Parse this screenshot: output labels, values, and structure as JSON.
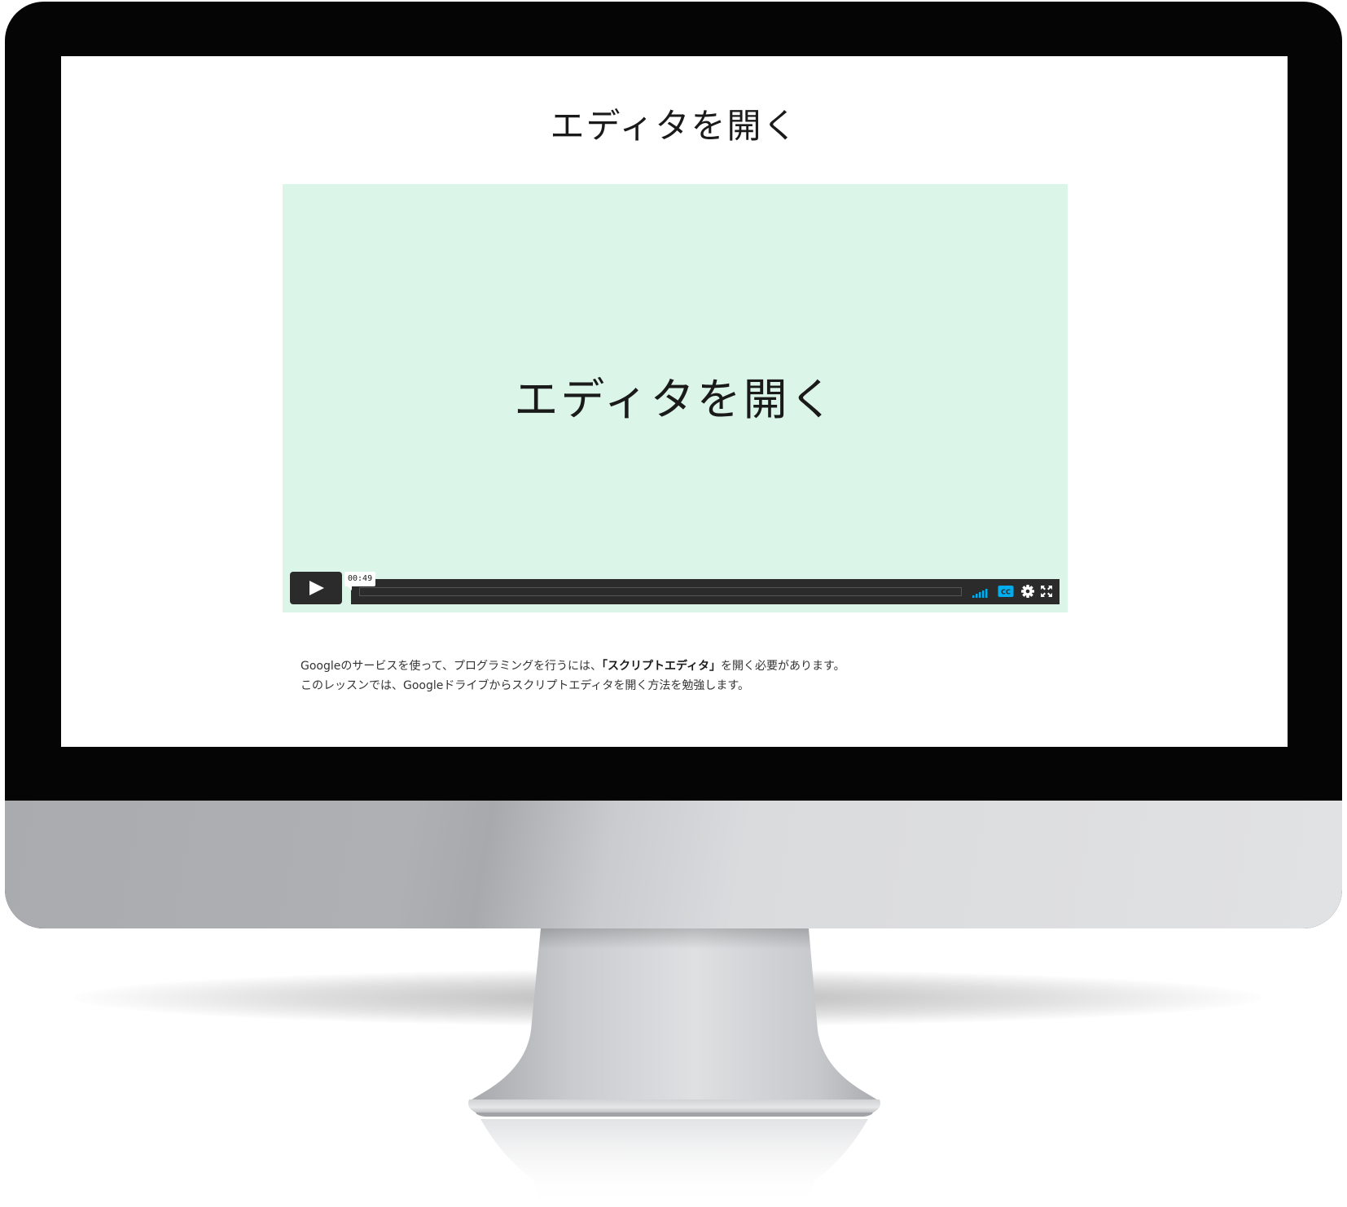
{
  "page": {
    "title": "エディタを開く"
  },
  "video": {
    "title_card": "エディタを開く",
    "time_tooltip": "00:49",
    "progress": 0,
    "colors": {
      "background": "#dbf5e8",
      "controls": "#2b2b2b",
      "accent": "#00adef"
    },
    "icons": {
      "play": "play-icon",
      "volume": "volume-icon",
      "captions": "closed-captions-icon",
      "settings": "gear-icon",
      "fullscreen": "fullscreen-icon"
    }
  },
  "description": {
    "line1_before": "Googleのサービスを使って、プログラミングを行うには、",
    "line1_bold": "「スクリプトエディタ」",
    "line1_after": "を開く必要があります。",
    "line2": "このレッスンでは、Googleドライブからスクリプトエディタを開く方法を勉強します。"
  }
}
